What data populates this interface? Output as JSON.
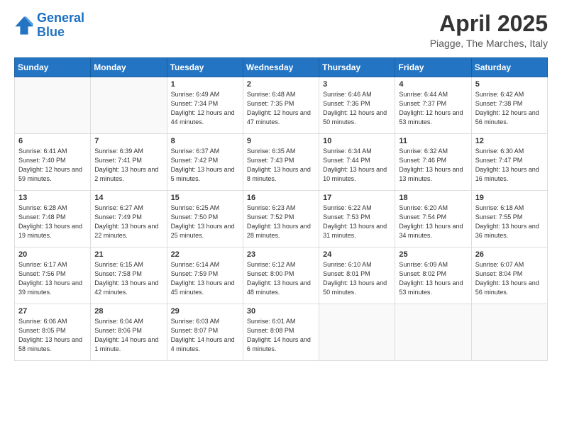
{
  "logo": {
    "line1": "General",
    "line2": "Blue"
  },
  "title": "April 2025",
  "subtitle": "Piagge, The Marches, Italy",
  "days_of_week": [
    "Sunday",
    "Monday",
    "Tuesday",
    "Wednesday",
    "Thursday",
    "Friday",
    "Saturday"
  ],
  "weeks": [
    [
      {
        "day": "",
        "info": ""
      },
      {
        "day": "",
        "info": ""
      },
      {
        "day": "1",
        "info": "Sunrise: 6:49 AM\nSunset: 7:34 PM\nDaylight: 12 hours and 44 minutes."
      },
      {
        "day": "2",
        "info": "Sunrise: 6:48 AM\nSunset: 7:35 PM\nDaylight: 12 hours and 47 minutes."
      },
      {
        "day": "3",
        "info": "Sunrise: 6:46 AM\nSunset: 7:36 PM\nDaylight: 12 hours and 50 minutes."
      },
      {
        "day": "4",
        "info": "Sunrise: 6:44 AM\nSunset: 7:37 PM\nDaylight: 12 hours and 53 minutes."
      },
      {
        "day": "5",
        "info": "Sunrise: 6:42 AM\nSunset: 7:38 PM\nDaylight: 12 hours and 56 minutes."
      }
    ],
    [
      {
        "day": "6",
        "info": "Sunrise: 6:41 AM\nSunset: 7:40 PM\nDaylight: 12 hours and 59 minutes."
      },
      {
        "day": "7",
        "info": "Sunrise: 6:39 AM\nSunset: 7:41 PM\nDaylight: 13 hours and 2 minutes."
      },
      {
        "day": "8",
        "info": "Sunrise: 6:37 AM\nSunset: 7:42 PM\nDaylight: 13 hours and 5 minutes."
      },
      {
        "day": "9",
        "info": "Sunrise: 6:35 AM\nSunset: 7:43 PM\nDaylight: 13 hours and 8 minutes."
      },
      {
        "day": "10",
        "info": "Sunrise: 6:34 AM\nSunset: 7:44 PM\nDaylight: 13 hours and 10 minutes."
      },
      {
        "day": "11",
        "info": "Sunrise: 6:32 AM\nSunset: 7:46 PM\nDaylight: 13 hours and 13 minutes."
      },
      {
        "day": "12",
        "info": "Sunrise: 6:30 AM\nSunset: 7:47 PM\nDaylight: 13 hours and 16 minutes."
      }
    ],
    [
      {
        "day": "13",
        "info": "Sunrise: 6:28 AM\nSunset: 7:48 PM\nDaylight: 13 hours and 19 minutes."
      },
      {
        "day": "14",
        "info": "Sunrise: 6:27 AM\nSunset: 7:49 PM\nDaylight: 13 hours and 22 minutes."
      },
      {
        "day": "15",
        "info": "Sunrise: 6:25 AM\nSunset: 7:50 PM\nDaylight: 13 hours and 25 minutes."
      },
      {
        "day": "16",
        "info": "Sunrise: 6:23 AM\nSunset: 7:52 PM\nDaylight: 13 hours and 28 minutes."
      },
      {
        "day": "17",
        "info": "Sunrise: 6:22 AM\nSunset: 7:53 PM\nDaylight: 13 hours and 31 minutes."
      },
      {
        "day": "18",
        "info": "Sunrise: 6:20 AM\nSunset: 7:54 PM\nDaylight: 13 hours and 34 minutes."
      },
      {
        "day": "19",
        "info": "Sunrise: 6:18 AM\nSunset: 7:55 PM\nDaylight: 13 hours and 36 minutes."
      }
    ],
    [
      {
        "day": "20",
        "info": "Sunrise: 6:17 AM\nSunset: 7:56 PM\nDaylight: 13 hours and 39 minutes."
      },
      {
        "day": "21",
        "info": "Sunrise: 6:15 AM\nSunset: 7:58 PM\nDaylight: 13 hours and 42 minutes."
      },
      {
        "day": "22",
        "info": "Sunrise: 6:14 AM\nSunset: 7:59 PM\nDaylight: 13 hours and 45 minutes."
      },
      {
        "day": "23",
        "info": "Sunrise: 6:12 AM\nSunset: 8:00 PM\nDaylight: 13 hours and 48 minutes."
      },
      {
        "day": "24",
        "info": "Sunrise: 6:10 AM\nSunset: 8:01 PM\nDaylight: 13 hours and 50 minutes."
      },
      {
        "day": "25",
        "info": "Sunrise: 6:09 AM\nSunset: 8:02 PM\nDaylight: 13 hours and 53 minutes."
      },
      {
        "day": "26",
        "info": "Sunrise: 6:07 AM\nSunset: 8:04 PM\nDaylight: 13 hours and 56 minutes."
      }
    ],
    [
      {
        "day": "27",
        "info": "Sunrise: 6:06 AM\nSunset: 8:05 PM\nDaylight: 13 hours and 58 minutes."
      },
      {
        "day": "28",
        "info": "Sunrise: 6:04 AM\nSunset: 8:06 PM\nDaylight: 14 hours and 1 minute."
      },
      {
        "day": "29",
        "info": "Sunrise: 6:03 AM\nSunset: 8:07 PM\nDaylight: 14 hours and 4 minutes."
      },
      {
        "day": "30",
        "info": "Sunrise: 6:01 AM\nSunset: 8:08 PM\nDaylight: 14 hours and 6 minutes."
      },
      {
        "day": "",
        "info": ""
      },
      {
        "day": "",
        "info": ""
      },
      {
        "day": "",
        "info": ""
      }
    ]
  ]
}
